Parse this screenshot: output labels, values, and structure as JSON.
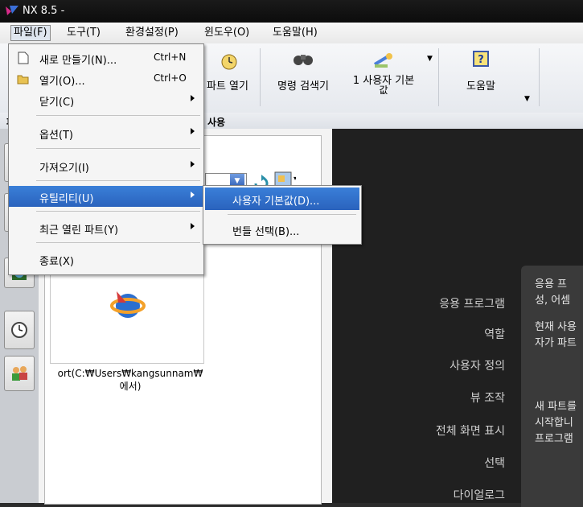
{
  "window": {
    "title": "NX 8.5 -"
  },
  "menubar": {
    "items": [
      "파일(F)",
      "도구(T)",
      "환경설정(P)",
      "윈도우(O)",
      "도움말(H)"
    ]
  },
  "toolbar": {
    "items": [
      "파트 열기",
      "명령 검색기",
      "1 사용자 기본",
      "값",
      "도움말"
    ]
  },
  "subbar": {
    "label": "사용"
  },
  "file_menu": {
    "items": [
      {
        "label": "새로 만들기(N)...",
        "shortcut": "Ctrl+N"
      },
      {
        "label": "열기(O)...",
        "shortcut": "Ctrl+O"
      },
      {
        "label": "닫기(C)"
      },
      {
        "label": "옵션(T)"
      },
      {
        "label": "가져오기(I)"
      },
      {
        "label": "유틸리티(U)"
      },
      {
        "label": "최근 열린 파트(Y)"
      },
      {
        "label": "종료(X)"
      }
    ]
  },
  "utility_submenu": {
    "items": [
      "사용자 기본값(D)...",
      "번들 선택(B)..."
    ]
  },
  "resource_panel": {
    "path_text": "ort(C:₩Users₩kangsunnam₩",
    "path_text2": "에서)"
  },
  "nav": {
    "items": [
      "응용 프로그램",
      "역할",
      "사용자 정의",
      "뷰 조작",
      "전체 화면 표시",
      "선택",
      "다이얼로그"
    ]
  },
  "tip": {
    "lines": [
      "응용 프",
      "성, 어셈",
      "현재 사용",
      "자가 파트",
      "새 파트를",
      "시작합니",
      "프로그램"
    ]
  },
  "colors": {
    "highlight": "#2f6fcb",
    "dark_bg": "#202020",
    "panel_bg": "#3a3a3a"
  }
}
